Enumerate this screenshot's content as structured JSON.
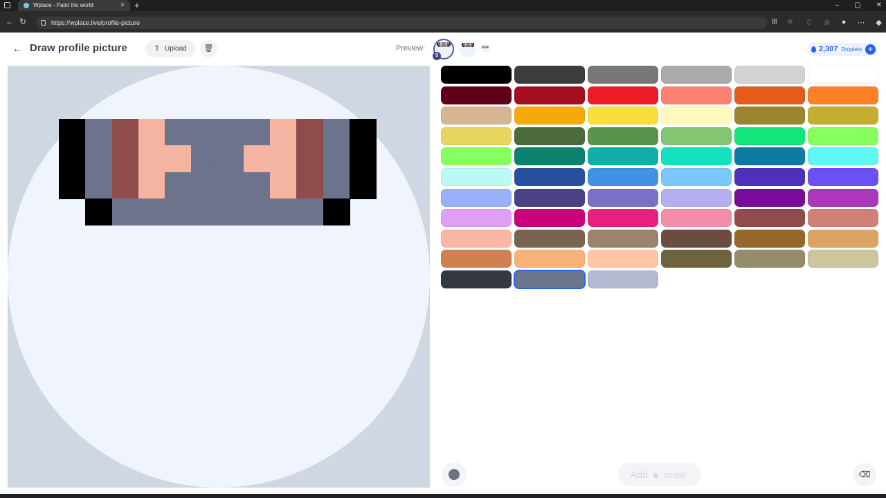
{
  "browser": {
    "tab_title": "Wplace - Paint the world",
    "tab_close": "×",
    "new_tab": "+",
    "url": "https://wplace.live/profile-picture",
    "back": "←",
    "reload": "↻",
    "minimize": "–",
    "restore": "▢",
    "close": "✕"
  },
  "header": {
    "title": "Draw profile picture",
    "back_icon": "←",
    "upload_label": "Upload",
    "upload_icon": "⇧",
    "delete_icon": "🗑",
    "preview_label": "Preview:",
    "level": "5",
    "droplets_count": "2,307",
    "droplets_unit": "Droplets",
    "droplets_plus": "+"
  },
  "canvas": {
    "grid_size": 16,
    "pixels": [
      {
        "col": 2,
        "row": 2,
        "color": "#000000"
      },
      {
        "col": 2,
        "row": 3,
        "color": "#000000"
      },
      {
        "col": 2,
        "row": 4,
        "color": "#000000"
      },
      {
        "col": 3,
        "row": 2,
        "color": "#6d738c"
      },
      {
        "col": 3,
        "row": 3,
        "color": "#6d738c"
      },
      {
        "col": 3,
        "row": 4,
        "color": "#6d738c"
      },
      {
        "col": 3,
        "row": 5,
        "color": "#000000"
      },
      {
        "col": 4,
        "row": 2,
        "color": "#904b4b"
      },
      {
        "col": 4,
        "row": 3,
        "color": "#904b4b"
      },
      {
        "col": 4,
        "row": 4,
        "color": "#904b4b"
      },
      {
        "col": 4,
        "row": 5,
        "color": "#6d738c"
      },
      {
        "col": 5,
        "row": 2,
        "color": "#f5b3a2"
      },
      {
        "col": 5,
        "row": 3,
        "color": "#f5b3a2"
      },
      {
        "col": 5,
        "row": 4,
        "color": "#f5b3a2"
      },
      {
        "col": 5,
        "row": 5,
        "color": "#6d738c"
      },
      {
        "col": 6,
        "row": 2,
        "color": "#6d738c"
      },
      {
        "col": 6,
        "row": 3,
        "color": "#f5b3a2"
      },
      {
        "col": 6,
        "row": 4,
        "color": "#6d738c"
      },
      {
        "col": 6,
        "row": 5,
        "color": "#6d738c"
      },
      {
        "col": 7,
        "row": 2,
        "color": "#6d738c"
      },
      {
        "col": 7,
        "row": 3,
        "color": "#6d738c"
      },
      {
        "col": 7,
        "row": 4,
        "color": "#6d738c"
      },
      {
        "col": 7,
        "row": 5,
        "color": "#6d738c"
      },
      {
        "col": 8,
        "row": 2,
        "color": "#6d738c"
      },
      {
        "col": 8,
        "row": 3,
        "color": "#6d738c"
      },
      {
        "col": 8,
        "row": 4,
        "color": "#6d738c"
      },
      {
        "col": 8,
        "row": 5,
        "color": "#6d738c"
      },
      {
        "col": 9,
        "row": 2,
        "color": "#6d738c"
      },
      {
        "col": 9,
        "row": 3,
        "color": "#f5b3a2"
      },
      {
        "col": 9,
        "row": 4,
        "color": "#6d738c"
      },
      {
        "col": 9,
        "row": 5,
        "color": "#6d738c"
      },
      {
        "col": 10,
        "row": 2,
        "color": "#f5b3a2"
      },
      {
        "col": 10,
        "row": 3,
        "color": "#f5b3a2"
      },
      {
        "col": 10,
        "row": 4,
        "color": "#f5b3a2"
      },
      {
        "col": 10,
        "row": 5,
        "color": "#6d738c"
      },
      {
        "col": 11,
        "row": 2,
        "color": "#904b4b"
      },
      {
        "col": 11,
        "row": 3,
        "color": "#904b4b"
      },
      {
        "col": 11,
        "row": 4,
        "color": "#904b4b"
      },
      {
        "col": 11,
        "row": 5,
        "color": "#6d738c"
      },
      {
        "col": 12,
        "row": 2,
        "color": "#6d738c"
      },
      {
        "col": 12,
        "row": 3,
        "color": "#6d738c"
      },
      {
        "col": 12,
        "row": 4,
        "color": "#6d738c"
      },
      {
        "col": 12,
        "row": 5,
        "color": "#000000"
      },
      {
        "col": 13,
        "row": 2,
        "color": "#000000"
      },
      {
        "col": 13,
        "row": 3,
        "color": "#000000"
      },
      {
        "col": 13,
        "row": 4,
        "color": "#000000"
      }
    ]
  },
  "palette": [
    "#000000",
    "#3c3c3c",
    "#787878",
    "#aaaaaa",
    "#d2d2d2",
    "#ffffff",
    "#600018",
    "#a50e1e",
    "#ed1c24",
    "#fa8072",
    "#e45c1a",
    "#ff7f27",
    "#d6b594",
    "#f6aa09",
    "#f9dd3b",
    "#fffabc",
    "#9c8431",
    "#c5ad31",
    "#e8d45f",
    "#4a6b3a",
    "#5a944a",
    "#84c573",
    "#13e67b",
    "#87ff5e",
    "#87ff5e",
    "#0c816e",
    "#10aea6",
    "#13e1be",
    "#0f799f",
    "#60f7f2",
    "#bbfaf2",
    "#28509e",
    "#4093e4",
    "#7dc7ff",
    "#4d31b8",
    "#6b50f6",
    "#99b1fb",
    "#4a4284",
    "#7a71c4",
    "#b5aef1",
    "#780c99",
    "#aa38b9",
    "#e09ff9",
    "#cb007a",
    "#ec1f80",
    "#f38da9",
    "#904b4b",
    "#d18078",
    "#fab6a4",
    "#7b6352",
    "#9c846b",
    "#6b4d40",
    "#95682a",
    "#dba463",
    "#d18051",
    "#f8b277",
    "#ffc5a5",
    "#6d643f",
    "#948c6b",
    "#cdc59e",
    "#333941",
    "#6d758d",
    "#b3b9d1"
  ],
  "selected_color_index": 61,
  "footer": {
    "add_label": "Add",
    "add_cost": "20,000",
    "eraser_icon": "⌫"
  }
}
